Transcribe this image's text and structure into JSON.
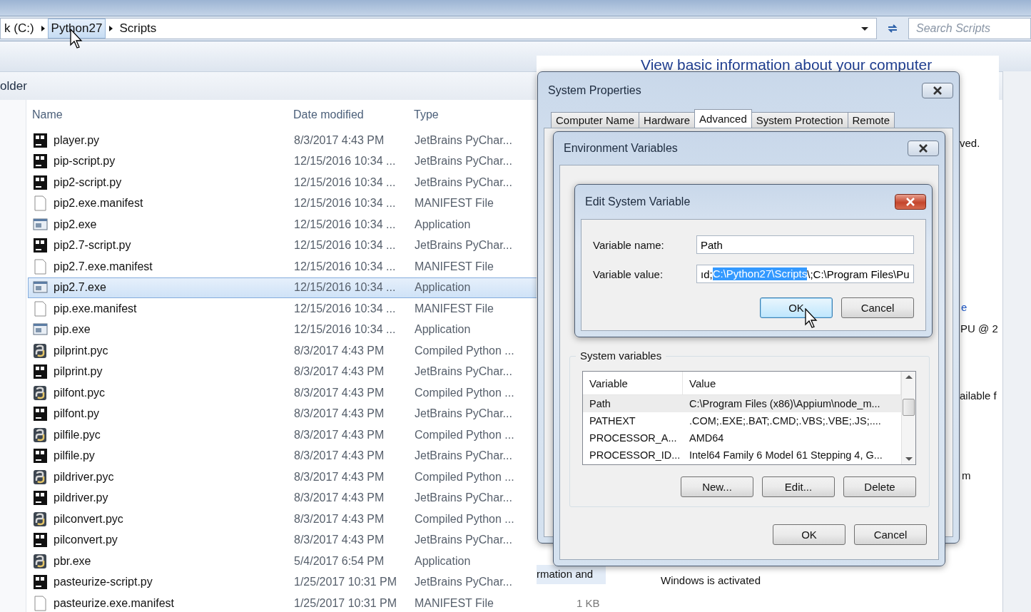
{
  "address_bar": {
    "crumbs": [
      "k (C:)",
      "Python27",
      "Scripts"
    ],
    "search": {
      "placeholder": "Search Scripts"
    }
  },
  "explorer": {
    "pane_label": "older",
    "columns": [
      "Name",
      "Date modified",
      "Type"
    ],
    "files": [
      {
        "name": "player.py",
        "date": "8/3/2017 4:43 PM",
        "type": "JetBrains PyChar...",
        "kind": "pycharm",
        "selected": false
      },
      {
        "name": "pip-script.py",
        "date": "12/15/2016 10:34 ...",
        "type": "JetBrains PyChar...",
        "kind": "pycharm",
        "selected": false
      },
      {
        "name": "pip2-script.py",
        "date": "12/15/2016 10:34 ...",
        "type": "JetBrains PyChar...",
        "kind": "pycharm",
        "selected": false
      },
      {
        "name": "pip2.exe.manifest",
        "date": "12/15/2016 10:34 ...",
        "type": "MANIFEST File",
        "kind": "file",
        "selected": false
      },
      {
        "name": "pip2.exe",
        "date": "12/15/2016 10:34 ...",
        "type": "Application",
        "kind": "app",
        "selected": false
      },
      {
        "name": "pip2.7-script.py",
        "date": "12/15/2016 10:34 ...",
        "type": "JetBrains PyChar...",
        "kind": "pycharm",
        "selected": false
      },
      {
        "name": "pip2.7.exe.manifest",
        "date": "12/15/2016 10:34 ...",
        "type": "MANIFEST File",
        "kind": "file",
        "selected": false
      },
      {
        "name": "pip2.7.exe",
        "date": "12/15/2016 10:34 ...",
        "type": "Application",
        "kind": "app",
        "selected": true
      },
      {
        "name": "pip.exe.manifest",
        "date": "12/15/2016 10:34 ...",
        "type": "MANIFEST File",
        "kind": "file",
        "selected": false
      },
      {
        "name": "pip.exe",
        "date": "12/15/2016 10:34 ...",
        "type": "Application",
        "kind": "app",
        "selected": false
      },
      {
        "name": "pilprint.pyc",
        "date": "8/3/2017 4:43 PM",
        "type": "Compiled Python ...",
        "kind": "python",
        "selected": false
      },
      {
        "name": "pilprint.py",
        "date": "8/3/2017 4:43 PM",
        "type": "JetBrains PyChar...",
        "kind": "pycharm",
        "selected": false
      },
      {
        "name": "pilfont.pyc",
        "date": "8/3/2017 4:43 PM",
        "type": "Compiled Python ...",
        "kind": "python",
        "selected": false
      },
      {
        "name": "pilfont.py",
        "date": "8/3/2017 4:43 PM",
        "type": "JetBrains PyChar...",
        "kind": "pycharm",
        "selected": false
      },
      {
        "name": "pilfile.pyc",
        "date": "8/3/2017 4:43 PM",
        "type": "Compiled Python ...",
        "kind": "python",
        "selected": false
      },
      {
        "name": "pilfile.py",
        "date": "8/3/2017 4:43 PM",
        "type": "JetBrains PyChar...",
        "kind": "pycharm",
        "selected": false
      },
      {
        "name": "pildriver.pyc",
        "date": "8/3/2017 4:43 PM",
        "type": "Compiled Python ...",
        "kind": "python",
        "selected": false
      },
      {
        "name": "pildriver.py",
        "date": "8/3/2017 4:43 PM",
        "type": "JetBrains PyChar...",
        "kind": "pycharm",
        "selected": false
      },
      {
        "name": "pilconvert.pyc",
        "date": "8/3/2017 4:43 PM",
        "type": "Compiled Python ...",
        "kind": "python",
        "selected": false
      },
      {
        "name": "pilconvert.py",
        "date": "8/3/2017 4:43 PM",
        "type": "JetBrains PyChar...",
        "kind": "pycharm",
        "selected": false
      },
      {
        "name": "pbr.exe",
        "date": "5/4/2017 6:54 PM",
        "type": "Application",
        "kind": "python",
        "selected": false
      },
      {
        "name": "pasteurize-script.py",
        "date": "1/25/2017 10:31 PM",
        "type": "JetBrains PyChar...",
        "kind": "pycharm",
        "selected": false
      },
      {
        "name": "pasteurize.exe.manifest",
        "date": "1/25/2017 10:31 PM",
        "type": "MANIFEST File",
        "kind": "file",
        "selected": false
      }
    ]
  },
  "background_window": {
    "heading": "View basic information about your computer",
    "fragments": [
      {
        "text": "ved.",
        "kind": "text"
      },
      {
        "text": "e",
        "kind": "link"
      },
      {
        "text": "PU @ 2",
        "kind": "text"
      },
      {
        "text": "ailable f",
        "kind": "text"
      },
      {
        "text": "m",
        "kind": "text"
      },
      {
        "text": "rmation and",
        "kind": "nav"
      },
      {
        "text": "Windows is activated",
        "kind": "text"
      },
      {
        "text": "1 KB",
        "kind": "muted"
      }
    ]
  },
  "system_properties": {
    "title": "System Properties",
    "tabs": [
      {
        "label": "Computer Name",
        "selected": false
      },
      {
        "label": "Hardware",
        "selected": false
      },
      {
        "label": "Advanced",
        "selected": true
      },
      {
        "label": "System Protection",
        "selected": false
      },
      {
        "label": "Remote",
        "selected": false
      }
    ]
  },
  "environment_variables": {
    "title": "Environment Variables",
    "group_label": "System variables",
    "columns": [
      "Variable",
      "Value"
    ],
    "rows": [
      {
        "variable": "Path",
        "value": "C:\\Program Files (x86)\\Appium\\node_m...",
        "selected": true
      },
      {
        "variable": "PATHEXT",
        "value": ".COM;.EXE;.BAT;.CMD;.VBS;.VBE;.JS;....",
        "selected": false
      },
      {
        "variable": "PROCESSOR_A...",
        "value": "AMD64",
        "selected": false
      },
      {
        "variable": "PROCESSOR_ID...",
        "value": "Intel64 Family 6 Model 61 Stepping 4, G...",
        "selected": false
      }
    ],
    "buttons": [
      "New...",
      "Edit...",
      "Delete"
    ],
    "dialog_buttons": [
      "OK",
      "Cancel"
    ]
  },
  "edit_variable": {
    "title": "Edit System Variable",
    "name_label": "Variable name:",
    "name_value": "Path",
    "value_label": "Variable value:",
    "value_start": "ıd;",
    "value_selected": "C:\\Python27\\Scripts",
    "value_end": "\\;C:\\Program Files\\Pu",
    "buttons": [
      {
        "label": "OK",
        "focused": true
      },
      {
        "label": "Cancel",
        "focused": false
      }
    ]
  }
}
